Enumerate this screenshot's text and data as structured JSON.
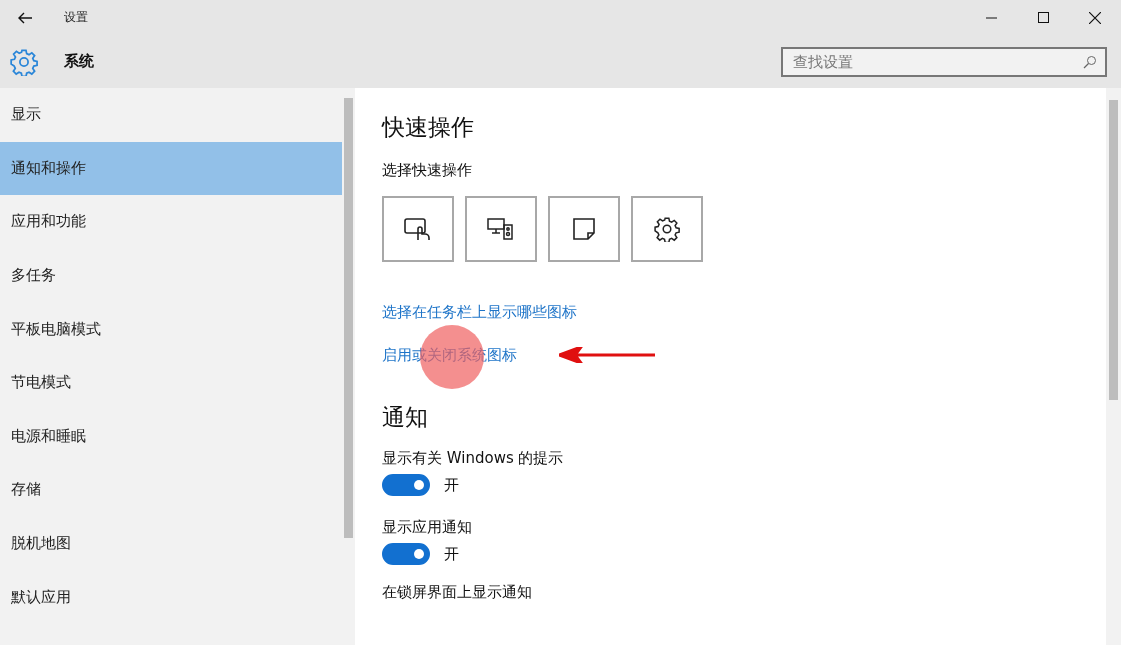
{
  "window": {
    "title": "设置"
  },
  "header": {
    "title": "系统",
    "search": {
      "placeholder": "查找设置"
    }
  },
  "sidebar": {
    "items": [
      {
        "label": "显示",
        "selected": false
      },
      {
        "label": "通知和操作",
        "selected": true
      },
      {
        "label": "应用和功能",
        "selected": false
      },
      {
        "label": "多任务",
        "selected": false
      },
      {
        "label": "平板电脑模式",
        "selected": false
      },
      {
        "label": "节电模式",
        "selected": false
      },
      {
        "label": "电源和睡眠",
        "selected": false
      },
      {
        "label": "存储",
        "selected": false
      },
      {
        "label": "脱机地图",
        "selected": false
      },
      {
        "label": "默认应用",
        "selected": false
      }
    ]
  },
  "quick_actions": {
    "heading": "快速操作",
    "subheading": "选择快速操作",
    "tiles": [
      {
        "kind": "tablet"
      },
      {
        "kind": "connect"
      },
      {
        "kind": "note"
      },
      {
        "kind": "settings"
      }
    ],
    "links": [
      {
        "label": "选择在任务栏上显示哪些图标",
        "highlighted": false
      },
      {
        "label": "启用或关闭系统图标",
        "highlighted": true
      }
    ]
  },
  "notifications": {
    "heading": "通知",
    "settings": [
      {
        "label": "显示有关 Windows 的提示",
        "on": true,
        "state": "开"
      },
      {
        "label": "显示应用通知",
        "on": true,
        "state": "开"
      }
    ],
    "cut_label": "在锁屏界面上显示通知"
  }
}
